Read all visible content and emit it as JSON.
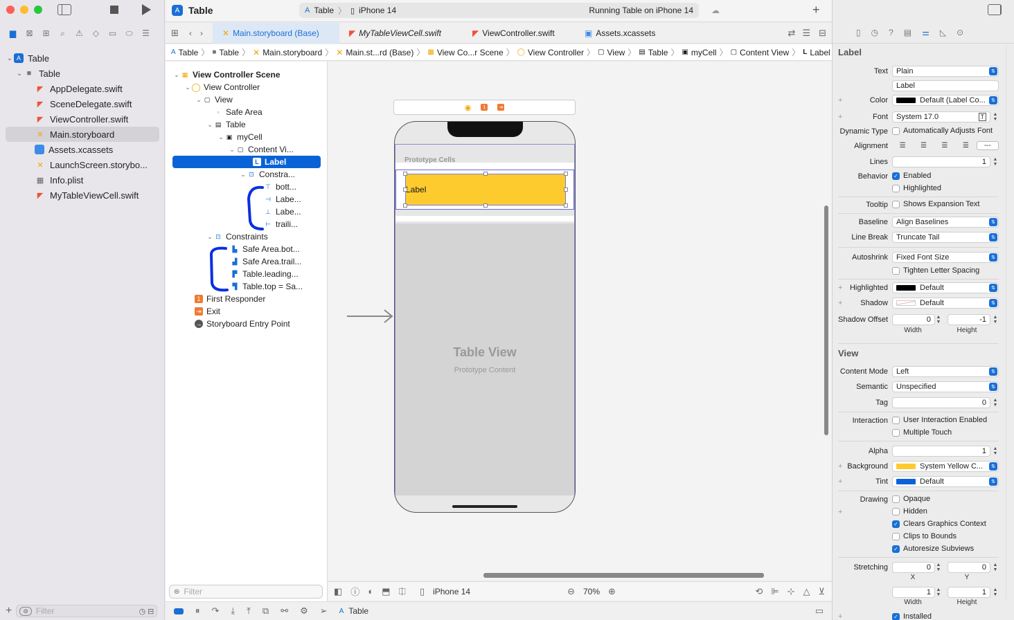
{
  "window": {
    "project_title": "Table",
    "scheme": "Table",
    "device": "iPhone 14",
    "status": "Running Table on iPhone 14"
  },
  "tabs": [
    {
      "label": "Main.storyboard (Base)"
    },
    {
      "label": "MyTableViewCell.swift"
    },
    {
      "label": "ViewController.swift"
    },
    {
      "label": "Assets.xcassets"
    }
  ],
  "breadcrumb": [
    "Table",
    "Table",
    "Main.storyboard",
    "Main.st...rd (Base)",
    "View Co...r Scene",
    "View Controller",
    "View",
    "Table",
    "myCell",
    "Content View",
    "Label"
  ],
  "navigator": {
    "project": "Table",
    "group": "Table",
    "files": [
      "AppDelegate.swift",
      "SceneDelegate.swift",
      "ViewController.swift",
      "Main.storyboard",
      "Assets.xcassets",
      "LaunchScreen.storybo...",
      "Info.plist",
      "MyTableViewCell.swift"
    ],
    "filter_placeholder": "Filter"
  },
  "outline": {
    "scene": "View Controller Scene",
    "view_controller": "View Controller",
    "view": "View",
    "safe_area": "Safe Area",
    "table": "Table",
    "cell": "myCell",
    "content_view": "Content Vi...",
    "label": "Label",
    "constraints_inner": "Constra...",
    "inner_constraints": [
      "bott...",
      "Labe...",
      "Labe...",
      "traili..."
    ],
    "constraints_outer": "Constraints",
    "outer_constraints": [
      "Safe Area.bot...",
      "Safe Area.trail...",
      "Table.leading...",
      "Table.top = Sa..."
    ],
    "first_responder": "First Responder",
    "exit": "Exit",
    "entry_point": "Storyboard Entry Point",
    "filter_placeholder": "Filter"
  },
  "canvas": {
    "prototype_cells": "Prototype Cells",
    "label_text": "Label",
    "table_view": "Table View",
    "prototype_content": "Prototype Content",
    "device": "iPhone 14",
    "zoom": "70%"
  },
  "debug": {
    "target": "Table"
  },
  "inspector": {
    "label_section": "Label",
    "text_label": "Text",
    "text_value": "Plain",
    "text_content": "Label",
    "color_label": "Color",
    "color_value": "Default (Label Co...",
    "font_label": "Font",
    "font_value": "System 17.0",
    "dynamic_type_label": "Dynamic Type",
    "dynamic_type_value": "Automatically Adjusts Font",
    "alignment_label": "Alignment",
    "lines_label": "Lines",
    "lines_value": "1",
    "behavior_label": "Behavior",
    "enabled": "Enabled",
    "highlighted": "Highlighted",
    "tooltip_label": "Tooltip",
    "tooltip_value": "Shows Expansion Text",
    "baseline_label": "Baseline",
    "baseline_value": "Align Baselines",
    "line_break_label": "Line Break",
    "line_break_value": "Truncate Tail",
    "autoshrink_label": "Autoshrink",
    "autoshrink_value": "Fixed Font Size",
    "tighten": "Tighten Letter Spacing",
    "highlighted_label": "Highlighted",
    "highlighted_value": "Default",
    "shadow_label": "Shadow",
    "shadow_value": "Default",
    "shadow_offset_label": "Shadow Offset",
    "shadow_w": "0",
    "shadow_h": "-1",
    "width": "Width",
    "height": "Height",
    "view_section": "View",
    "content_mode_label": "Content Mode",
    "content_mode_value": "Left",
    "semantic_label": "Semantic",
    "semantic_value": "Unspecified",
    "tag_label": "Tag",
    "tag_value": "0",
    "interaction_label": "Interaction",
    "user_interaction": "User Interaction Enabled",
    "multiple_touch": "Multiple Touch",
    "alpha_label": "Alpha",
    "alpha_value": "1",
    "background_label": "Background",
    "background_value": "System Yellow C...",
    "tint_label": "Tint",
    "tint_value": "Default",
    "drawing_label": "Drawing",
    "opaque": "Opaque",
    "hidden": "Hidden",
    "clears": "Clears Graphics Context",
    "clips": "Clips to Bounds",
    "autoresize": "Autoresize Subviews",
    "stretching_label": "Stretching",
    "stretch_x": "0",
    "stretch_y": "0",
    "x": "X",
    "y": "Y",
    "stretch_w": "1",
    "stretch_h": "1",
    "installed": "Installed"
  },
  "colors": {
    "accent": "#0a63d6",
    "yellow": "#fecb2f",
    "constraint_blue": "#0a2fe0"
  }
}
